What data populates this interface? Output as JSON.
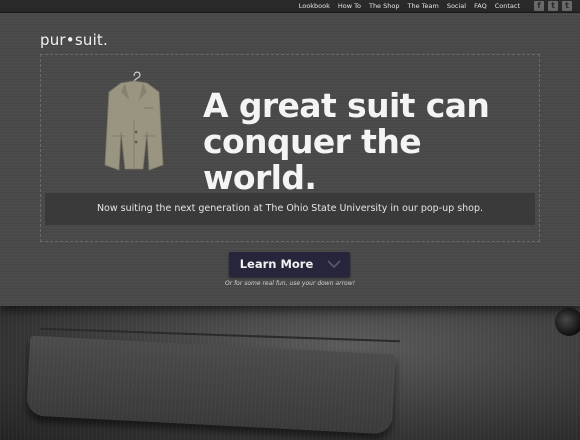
{
  "nav": {
    "items": [
      "Lookbook",
      "How To",
      "The Shop",
      "The Team",
      "Social",
      "FAQ",
      "Contact"
    ]
  },
  "social": {
    "icons": [
      {
        "name": "facebook-icon",
        "glyph": "f"
      },
      {
        "name": "twitter-icon",
        "glyph": "t"
      },
      {
        "name": "tumblr-icon",
        "glyph": "t"
      }
    ]
  },
  "brand": {
    "logo": "pur•suit."
  },
  "hero": {
    "headline": "A great suit can conquer the world.",
    "tagline": "Now suiting the next generation at The Ohio State University in our pop-up shop.",
    "cta_label": "Learn More",
    "hint": "Or for some real fun, use your down arrow!"
  },
  "colors": {
    "hero_bg": "#4a4a4a",
    "cta_bg": "#27253b",
    "suit_icon": "#9a9581"
  }
}
